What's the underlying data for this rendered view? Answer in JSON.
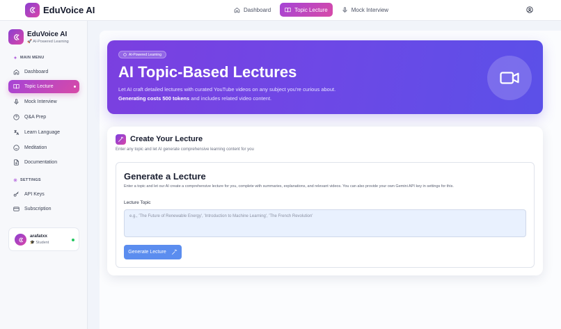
{
  "app": {
    "title": "EduVoice AI"
  },
  "header": {
    "nav": [
      {
        "label": "Dashboard",
        "icon": "home-icon",
        "active": false
      },
      {
        "label": "Topic Lecture",
        "icon": "book-icon",
        "active": true
      },
      {
        "label": "Mock Interview",
        "icon": "mic-icon",
        "active": false
      }
    ]
  },
  "sidebar": {
    "brand_name": "EduVoice AI",
    "brand_sub": "🚀 AI-Powered Learning",
    "main_menu_label": "MAIN MENU",
    "items": [
      {
        "label": "Dashboard",
        "icon": "home-icon"
      },
      {
        "label": "Topic Lecture",
        "icon": "book-icon",
        "active": true
      },
      {
        "label": "Mock Interview",
        "icon": "mic-icon"
      },
      {
        "label": "Q&A Prep",
        "icon": "help-circle-icon"
      },
      {
        "label": "Learn Language",
        "icon": "translate-icon"
      },
      {
        "label": "Meditation",
        "icon": "smile-icon"
      },
      {
        "label": "Documentation",
        "icon": "document-icon"
      }
    ],
    "settings_label": "SETTINGS",
    "settings_items": [
      {
        "label": "API Keys",
        "icon": "key-icon"
      },
      {
        "label": "Subscription",
        "icon": "card-icon"
      }
    ],
    "user": {
      "name": "arafatxx",
      "role": "🎓 Student"
    }
  },
  "hero": {
    "badge": "AI-Powered Learning",
    "title": "AI Topic-Based Lectures",
    "desc_part1": "Let AI craft detailed lectures with curated YouTube videos on any subject you're curious about. ",
    "desc_bold": "Generating costs 500 tokens",
    "desc_part2": " and includes related video content."
  },
  "create": {
    "title": "Create Your Lecture",
    "subtitle": "Enter any topic and let AI generate comprehensive learning content for you",
    "form_title": "Generate a Lecture",
    "form_desc": "Enter a topic and let our AI create a comprehensive lecture for you, complete with summaries, explanations, and relevant videos. You can also provide your own Gemini API key in settings for this.",
    "topic_label": "Lecture Topic",
    "topic_placeholder": "e.g., 'The Future of Renewable Energy', 'Introduction to Machine Learning', 'The French Revolution'",
    "topic_value": "",
    "button_label": "Generate Lecture"
  },
  "colors": {
    "accent": "#a544d6",
    "accent2": "#d74aa7",
    "hero": "#6d48e6",
    "button": "#5b8def"
  }
}
